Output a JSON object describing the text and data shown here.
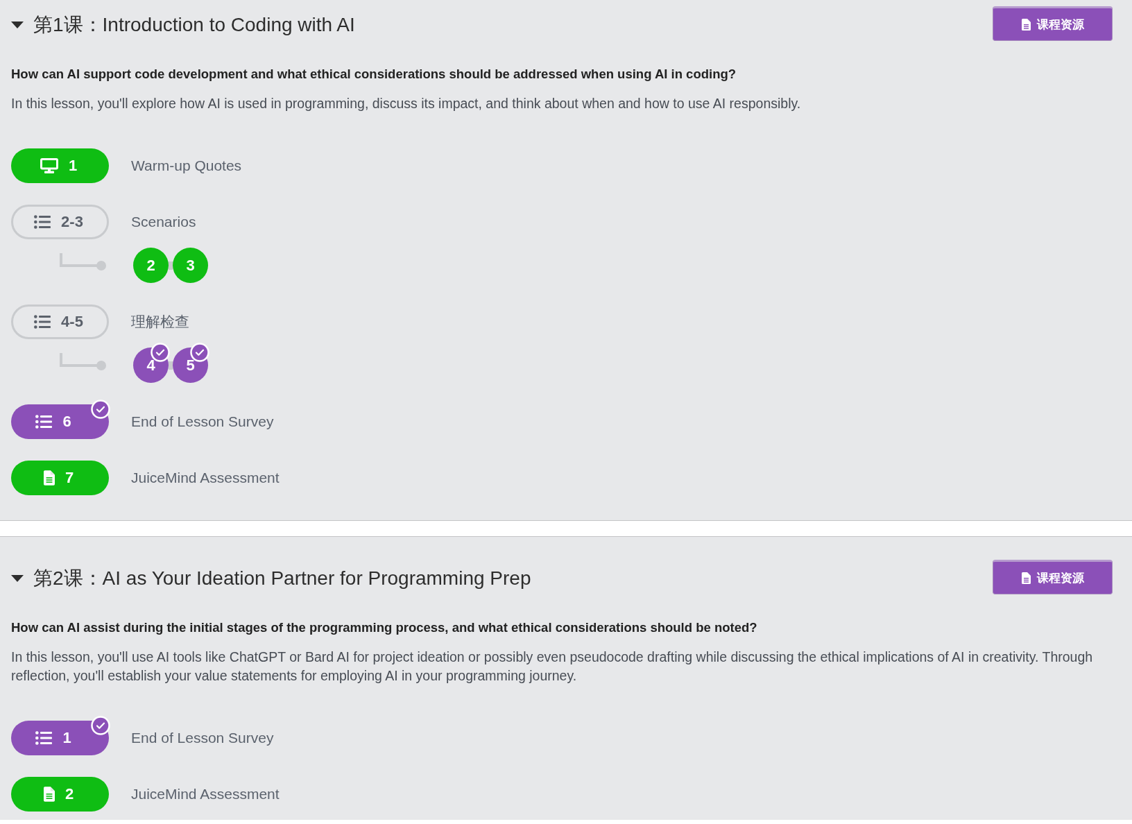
{
  "lessons": [
    {
      "title": "第1课：Introduction to Coding with AI",
      "expanded": true,
      "resources_button": "课程资源",
      "question": "How can AI support code development and what ethical considerations should be addressed when using AI in coding?",
      "description": "In this lesson, you'll explore how AI is used in programming, discuss its impact, and think about when and how to use AI responsibly.",
      "activities": [
        {
          "kind": "slides",
          "number": "1",
          "title": "Warm-up Quotes",
          "completed": false
        },
        {
          "kind": "group",
          "number": "2-3",
          "title": "Scenarios",
          "completed": false,
          "children": [
            {
              "number": "2",
              "completed": false
            },
            {
              "number": "3",
              "completed": false
            }
          ]
        },
        {
          "kind": "group",
          "number": "4-5",
          "title": "理解检查",
          "completed": false,
          "children": [
            {
              "number": "4",
              "completed": true
            },
            {
              "number": "5",
              "completed": true
            }
          ]
        },
        {
          "kind": "quiz",
          "number": "6",
          "title": "End of Lesson Survey",
          "completed": true
        },
        {
          "kind": "document",
          "number": "7",
          "title": "JuiceMind Assessment",
          "completed": false
        }
      ]
    },
    {
      "title": "第2课：AI as Your Ideation Partner for Programming Prep",
      "expanded": true,
      "resources_button": "课程资源",
      "question": "How can AI assist during the initial stages of the programming process, and what ethical considerations should be noted?",
      "description": "In this lesson, you'll use AI tools like ChatGPT or Bard AI for project ideation or possibly even pseudocode drafting while discussing the ethical implications of AI in creativity. Through reflection, you'll establish your value statements for employing AI in your programming journey.",
      "activities": [
        {
          "kind": "quiz",
          "number": "1",
          "title": "End of Lesson Survey",
          "completed": true
        },
        {
          "kind": "document",
          "number": "2",
          "title": "JuiceMind Assessment",
          "completed": false
        }
      ]
    }
  ]
}
